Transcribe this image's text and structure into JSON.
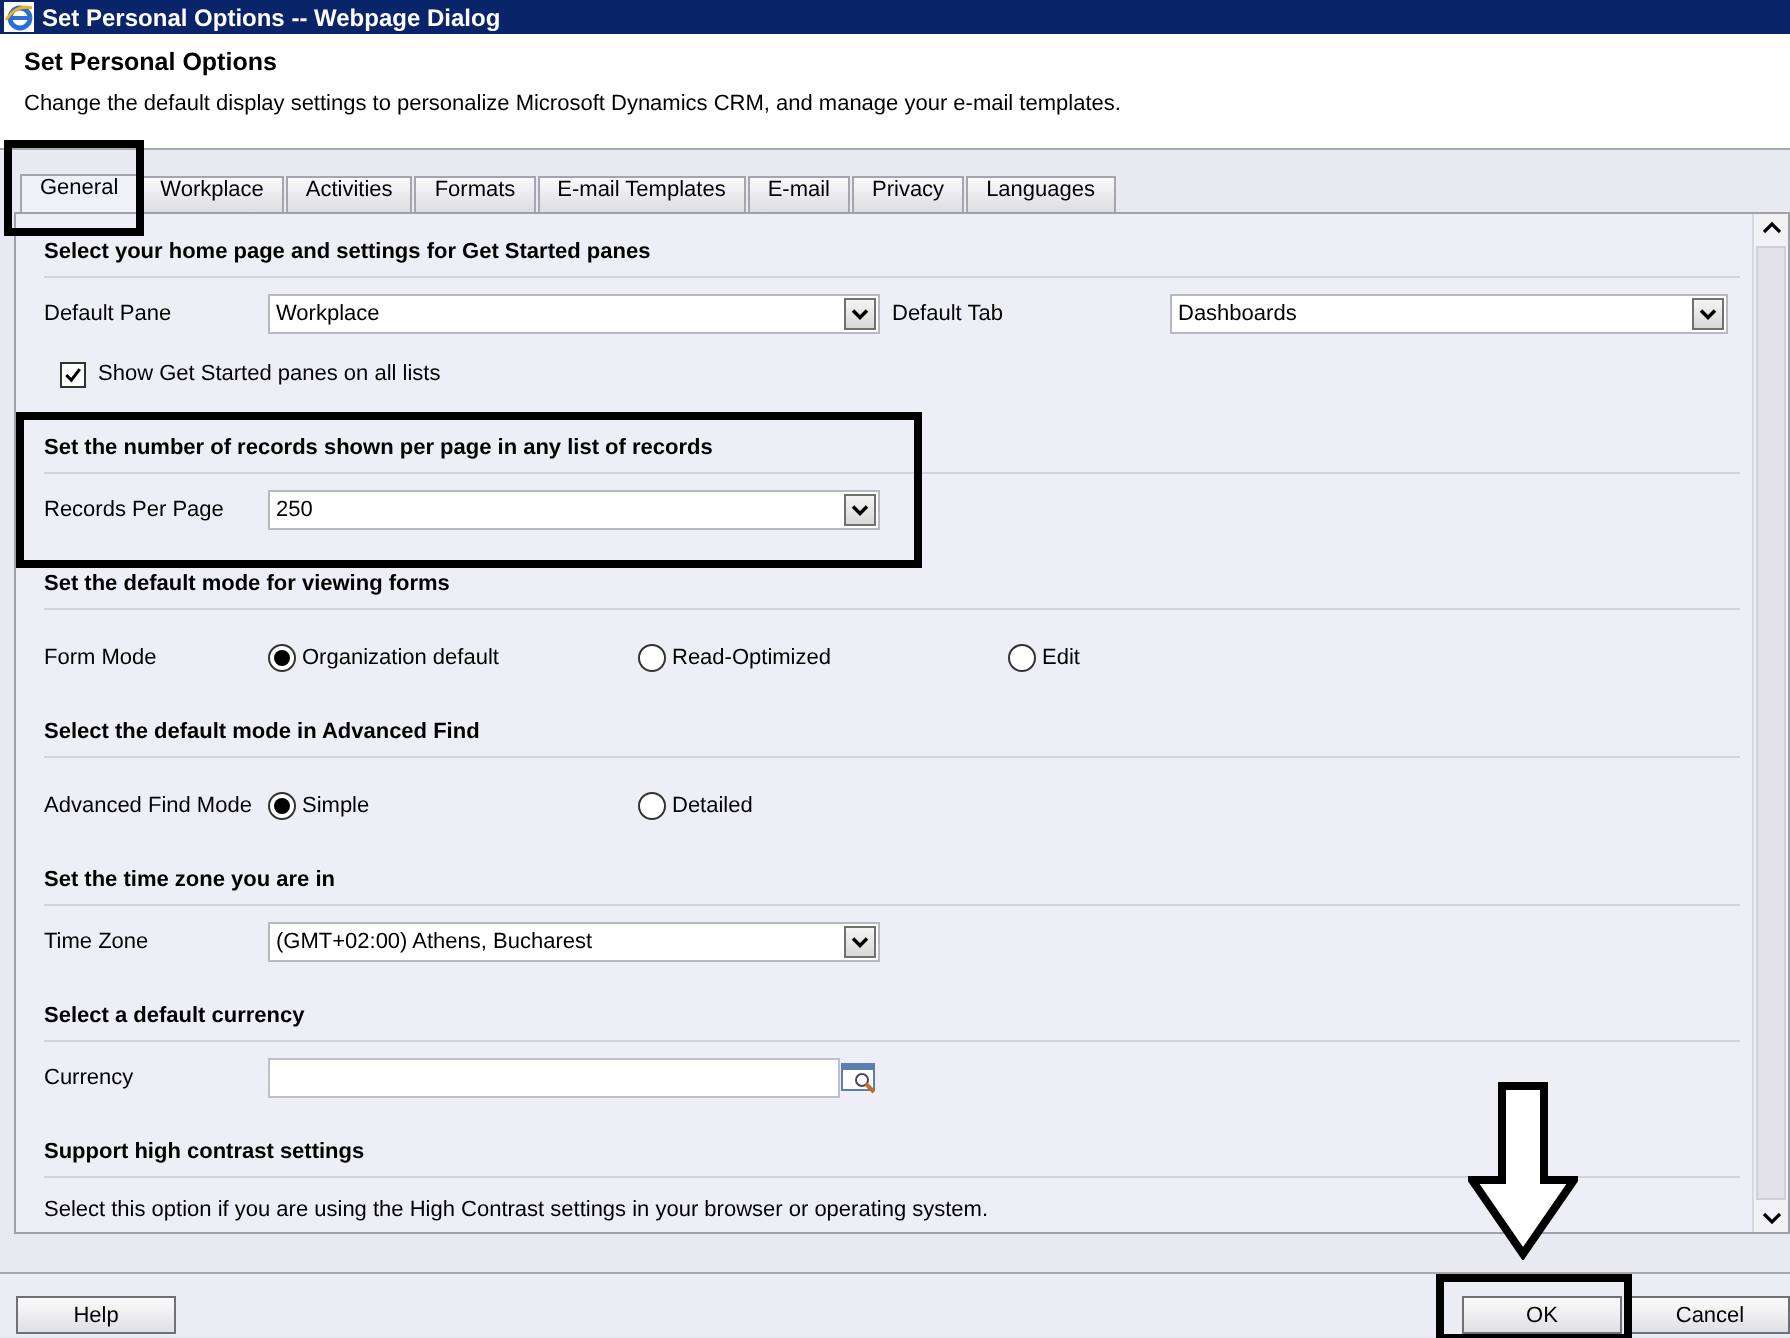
{
  "window": {
    "title": "Set Personal Options -- Webpage Dialog"
  },
  "header": {
    "title": "Set Personal Options",
    "description": "Change the default display settings to personalize Microsoft Dynamics CRM, and manage your e-mail templates."
  },
  "tabs": [
    {
      "label": "General",
      "selected": true,
      "highlighted": true
    },
    {
      "label": "Workplace",
      "selected": false,
      "highlighted": false
    },
    {
      "label": "Activities",
      "selected": false,
      "highlighted": false
    },
    {
      "label": "Formats",
      "selected": false,
      "highlighted": false
    },
    {
      "label": "E-mail Templates",
      "selected": false,
      "highlighted": false
    },
    {
      "label": "E-mail",
      "selected": false,
      "highlighted": false
    },
    {
      "label": "Privacy",
      "selected": false,
      "highlighted": false
    },
    {
      "label": "Languages",
      "selected": false,
      "highlighted": false
    }
  ],
  "sections": [
    {
      "heading": "Select your home page and settings for Get Started panes",
      "highlighted": false,
      "rows": [
        {
          "fields": [
            {
              "kind": "select",
              "label": "Default Pane",
              "value": "Workplace"
            },
            {
              "kind": "select",
              "label": "Default Tab",
              "value": "Dashboards"
            }
          ]
        },
        {
          "fields": [
            {
              "kind": "checkbox",
              "label": "Show Get Started panes on all lists",
              "checked": true
            }
          ]
        }
      ]
    },
    {
      "heading": "Set the number of records shown per page in any list of records",
      "highlighted": true,
      "rows": [
        {
          "fields": [
            {
              "kind": "select",
              "label": "Records Per Page",
              "value": "250"
            }
          ]
        }
      ]
    },
    {
      "heading": "Set the default mode for viewing forms",
      "highlighted": false,
      "rows": [
        {
          "fields": [
            {
              "kind": "radio",
              "label": "Form Mode",
              "options": [
                {
                  "label": "Organization default",
                  "selected": true
                },
                {
                  "label": "Read-Optimized",
                  "selected": false
                },
                {
                  "label": "Edit",
                  "selected": false
                }
              ]
            }
          ]
        }
      ]
    },
    {
      "heading": "Select the default mode in Advanced Find",
      "highlighted": false,
      "rows": [
        {
          "fields": [
            {
              "kind": "radio",
              "label": "Advanced Find Mode",
              "options": [
                {
                  "label": "Simple",
                  "selected": true
                },
                {
                  "label": "Detailed",
                  "selected": false
                }
              ]
            }
          ]
        }
      ]
    },
    {
      "heading": "Set the time zone you are in",
      "highlighted": false,
      "rows": [
        {
          "fields": [
            {
              "kind": "select",
              "label": "Time Zone",
              "value": "(GMT+02:00) Athens, Bucharest"
            }
          ]
        }
      ]
    },
    {
      "heading": "Select a default currency",
      "highlighted": false,
      "rows": [
        {
          "fields": [
            {
              "kind": "lookup",
              "label": "Currency"
            }
          ]
        }
      ]
    },
    {
      "heading": "Support high contrast settings",
      "highlighted": false,
      "rows": [
        {
          "fields": [
            {
              "kind": "note",
              "text": "Select this option if you are using the High Contrast settings in your browser or operating system."
            }
          ]
        }
      ]
    }
  ],
  "footer": {
    "left_buttons": [
      {
        "label": "Help",
        "highlighted": false
      }
    ],
    "right_buttons": [
      {
        "label": "OK",
        "highlighted": true
      },
      {
        "label": "Cancel",
        "highlighted": false
      }
    ]
  }
}
